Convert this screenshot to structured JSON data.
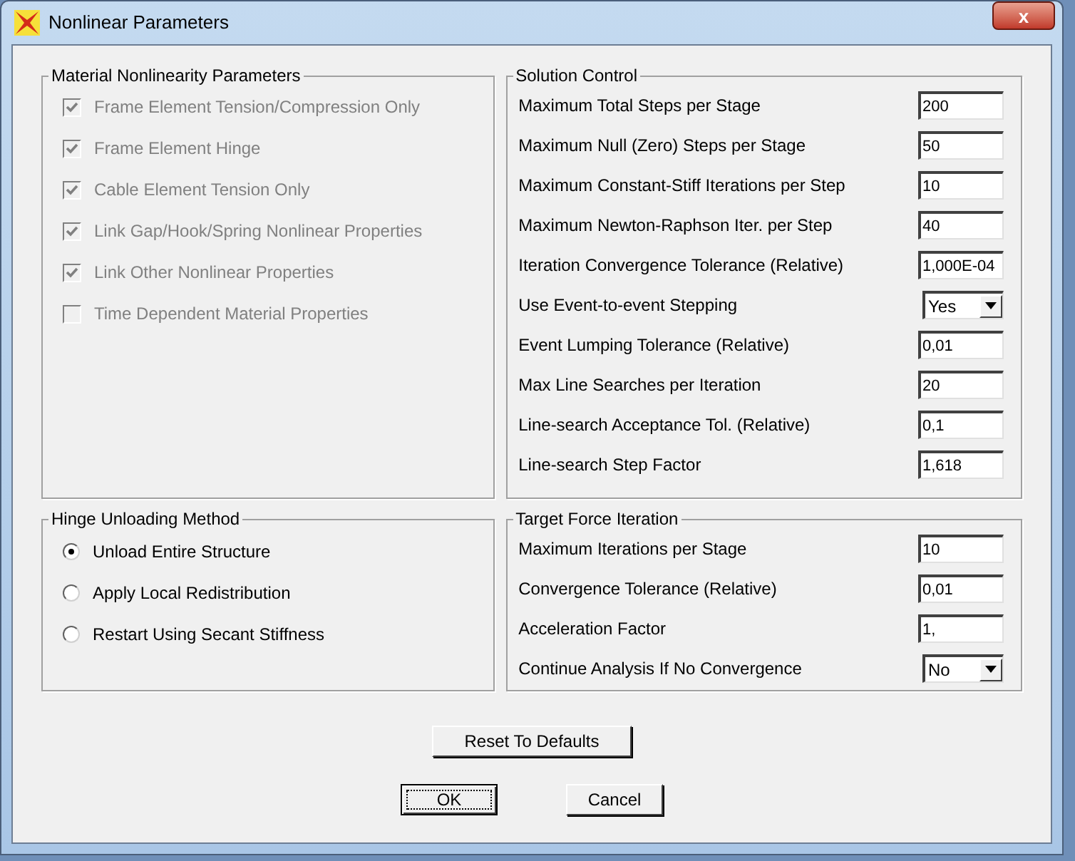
{
  "window": {
    "title": "Nonlinear Parameters",
    "close": "x"
  },
  "material_nonlinearity": {
    "title": "Material Nonlinearity Parameters",
    "items": [
      {
        "label": "Frame Element Tension/Compression Only",
        "checked": true,
        "disabled": true
      },
      {
        "label": "Frame Element Hinge",
        "checked": true,
        "disabled": true
      },
      {
        "label": "Cable Element Tension Only",
        "checked": true,
        "disabled": true
      },
      {
        "label": "Link Gap/Hook/Spring Nonlinear Properties",
        "checked": true,
        "disabled": true
      },
      {
        "label": "Link Other Nonlinear Properties",
        "checked": true,
        "disabled": true
      },
      {
        "label": "Time Dependent Material Properties",
        "checked": false,
        "disabled": true
      }
    ]
  },
  "solution_control": {
    "title": "Solution Control",
    "rows": [
      {
        "kind": "text",
        "label": "Maximum Total Steps per Stage",
        "value": "200"
      },
      {
        "kind": "text",
        "label": "Maximum Null (Zero) Steps per Stage",
        "value": "50"
      },
      {
        "kind": "text",
        "label": "Maximum Constant-Stiff Iterations per Step",
        "value": "10"
      },
      {
        "kind": "text",
        "label": "Maximum Newton-Raphson Iter. per Step",
        "value": "40"
      },
      {
        "kind": "text",
        "label": "Iteration Convergence Tolerance (Relative)",
        "value": "1,000E-04"
      },
      {
        "kind": "dropdown",
        "label": "Use Event-to-event Stepping",
        "value": "Yes"
      },
      {
        "kind": "text",
        "label": "Event Lumping Tolerance (Relative)",
        "value": "0,01"
      },
      {
        "kind": "text",
        "label": "Max Line Searches per Iteration",
        "value": "20"
      },
      {
        "kind": "text",
        "label": "Line-search Acceptance Tol. (Relative)",
        "value": "0,1"
      },
      {
        "kind": "text",
        "label": "Line-search Step Factor",
        "value": "1,618"
      }
    ]
  },
  "hinge_unloading": {
    "title": "Hinge Unloading Method",
    "options": [
      {
        "label": "Unload Entire Structure",
        "selected": true
      },
      {
        "label": "Apply Local Redistribution",
        "selected": false
      },
      {
        "label": "Restart Using Secant Stiffness",
        "selected": false
      }
    ]
  },
  "target_force_iteration": {
    "title": "Target Force Iteration",
    "rows": [
      {
        "kind": "text",
        "label": "Maximum Iterations per Stage",
        "value": "10"
      },
      {
        "kind": "text",
        "label": "Convergence Tolerance (Relative)",
        "value": "0,01"
      },
      {
        "kind": "text",
        "label": "Acceleration Factor",
        "value": "1,"
      },
      {
        "kind": "dropdown",
        "label": "Continue Analysis If No Convergence",
        "value": "No"
      }
    ]
  },
  "buttons": {
    "reset": "Reset To Defaults",
    "ok": "OK",
    "cancel": "Cancel"
  }
}
